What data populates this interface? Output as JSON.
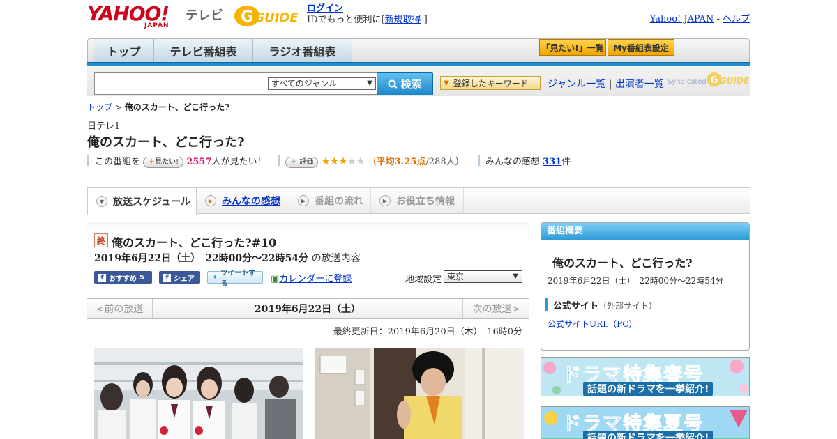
{
  "header": {
    "yahoo_logo": "YAHOO!",
    "yahoo_sub": "JAPAN",
    "tv_label": "テレビ",
    "gguide_logo": "G-GUIDE",
    "login": "ログイン",
    "login_note_pre": "IDでもっと便利に[",
    "register": "新規取得",
    "login_note_post": "]",
    "yahoo_japan_link": "Yahoo! JAPAN",
    "separator": "-",
    "help_link": "ヘルプ"
  },
  "nav": {
    "tabs": [
      "トップ",
      "テレビ番組表",
      "ラジオ番組表"
    ],
    "want_list": "「見たい!」一覧",
    "my_schedule": "My番組表設定"
  },
  "search": {
    "input_value": "",
    "genre_selected": "すべてのジャンル",
    "search_button": "検索",
    "keyword_button": "登録したキーワード",
    "genre_list": "ジャンル一覧",
    "divider": "|",
    "performer_list": "出演者一覧",
    "syndicated": "Syndicated"
  },
  "breadcrumb": {
    "top": "トップ",
    "sep": ">",
    "current": "俺のスカート、どこ行った?"
  },
  "program": {
    "channel": "日テレ1",
    "title": "俺のスカート、どこ行った?",
    "want_pre": "この番組を",
    "want_button": "見たい!",
    "want_count": "2557",
    "want_post": "人が見たい！",
    "rate_button": "評価",
    "rating_stars": 3,
    "rating_open": "（",
    "rating_avg": "平均3.25点",
    "rating_count": "/288人）",
    "reviews_pre": "みんなの感想",
    "reviews_count": "331",
    "reviews_post": "件"
  },
  "subtabs": [
    {
      "label": "放送スケジュール",
      "state": "active"
    },
    {
      "label": "みんなの感想",
      "state": "link"
    },
    {
      "label": "番組の流れ",
      "state": "disabled"
    },
    {
      "label": "お役立ち情報",
      "state": "disabled"
    }
  ],
  "episode": {
    "end_badge": "終",
    "title": "俺のスカート、どこ行った?#10",
    "datetime": "2019年6月22日（土）　22時00分～22時54分",
    "suffix": "の放送内容",
    "recommend": "おすすめ",
    "recommend_count": "5",
    "share": "シェア",
    "tweet": "ツイートする",
    "calendar": "カレンダーに登録",
    "region_label": "地域設定",
    "region_value": "東京"
  },
  "datebar": {
    "prev": "<前の放送",
    "current": "2019年6月22日（土）",
    "next": "次の放送>"
  },
  "updated": "最終更新日：2019年6月20日（木）　16時0分",
  "overview": {
    "header": "番組概要",
    "title": "俺のスカート、どこ行った?",
    "time": "2019年6月22日（土）　22時00分～22時54分",
    "official": "公式サイト",
    "official_note": "（外部サイト）",
    "url_link": "公式サイトURL（PC）"
  },
  "banners": [
    {
      "main": "ドラマ特集春号",
      "sub": "話題の新ドラマを一挙紹介!",
      "bg": "#bfe6f3"
    },
    {
      "main": "ドラマ特集夏号",
      "sub": "話題の新ドラマを一挙紹介!",
      "bg": "#9fd8f2"
    }
  ],
  "colors": {
    "accent_blue": "#1a8fd0",
    "link": "#0033cc",
    "pink": "#d6247c",
    "orange": "#e07000",
    "star": "#f0a400"
  }
}
